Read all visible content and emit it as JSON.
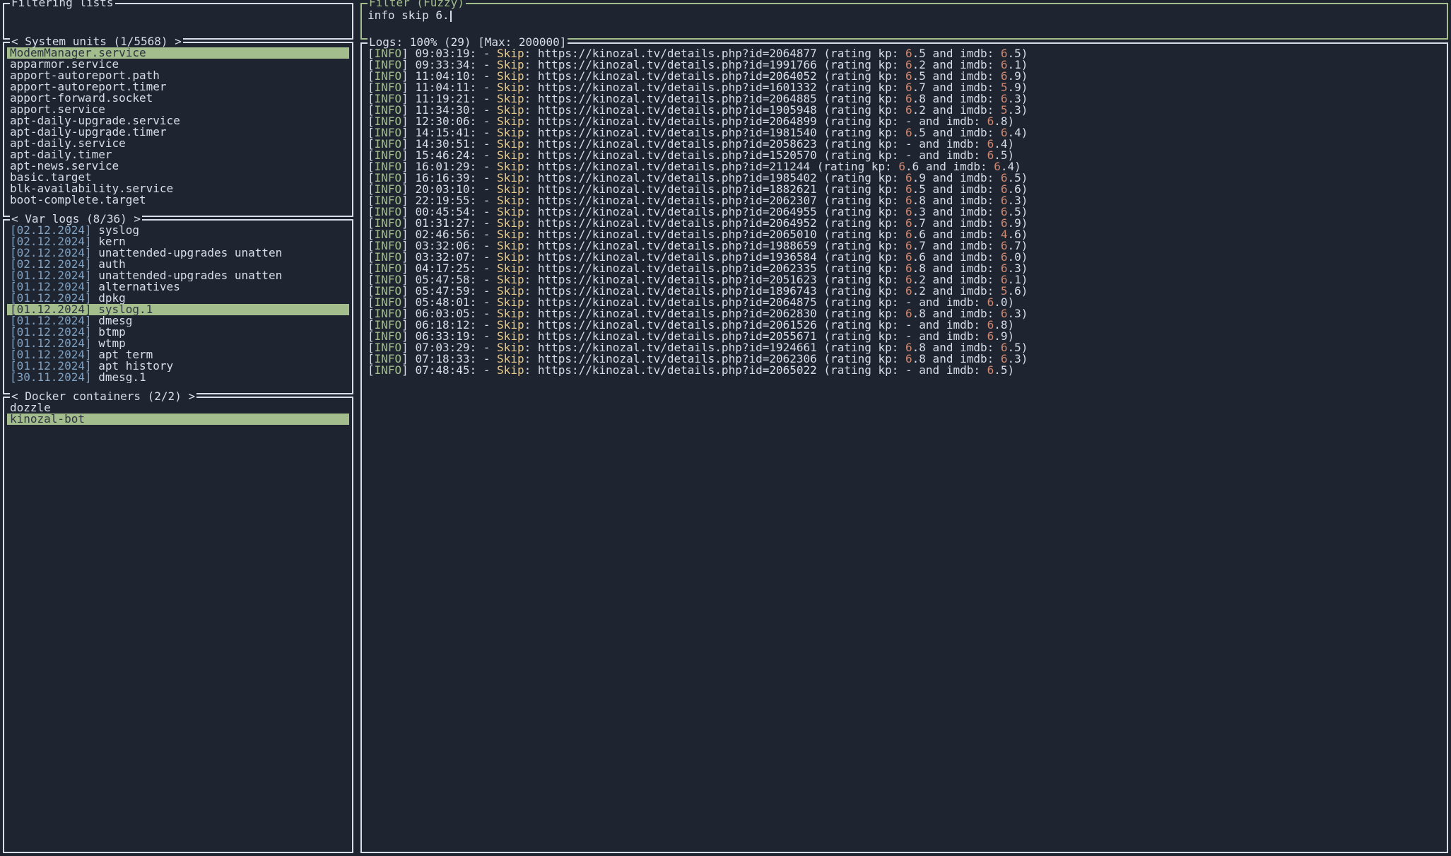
{
  "panels": {
    "filtering_lists_title": "Filtering lists",
    "filter_title": "Filter (Fuzzy)",
    "filter_value": "info skip 6.",
    "system_units_title": "< System units (1/5568) >",
    "var_logs_title": "< Var logs (8/36) >",
    "docker_title": "< Docker containers (2/2) >",
    "logs_title": "Logs: 100% (29) [Max: 200000]"
  },
  "system_units": [
    {
      "name": "ModemManager.service",
      "selected": true
    },
    {
      "name": "apparmor.service",
      "selected": false
    },
    {
      "name": "apport-autoreport.path",
      "selected": false
    },
    {
      "name": "apport-autoreport.timer",
      "selected": false
    },
    {
      "name": "apport-forward.socket",
      "selected": false
    },
    {
      "name": "apport.service",
      "selected": false
    },
    {
      "name": "apt-daily-upgrade.service",
      "selected": false
    },
    {
      "name": "apt-daily-upgrade.timer",
      "selected": false
    },
    {
      "name": "apt-daily.service",
      "selected": false
    },
    {
      "name": "apt-daily.timer",
      "selected": false
    },
    {
      "name": "apt-news.service",
      "selected": false
    },
    {
      "name": "basic.target",
      "selected": false
    },
    {
      "name": "blk-availability.service",
      "selected": false
    },
    {
      "name": "boot-complete.target",
      "selected": false
    }
  ],
  "var_logs": [
    {
      "date": "02.12.2024",
      "name": "syslog",
      "selected": false
    },
    {
      "date": "02.12.2024",
      "name": "kern",
      "selected": false
    },
    {
      "date": "02.12.2024",
      "name": "unattended-upgrades unatten",
      "selected": false
    },
    {
      "date": "02.12.2024",
      "name": "auth",
      "selected": false
    },
    {
      "date": "01.12.2024",
      "name": "unattended-upgrades unatten",
      "selected": false
    },
    {
      "date": "01.12.2024",
      "name": "alternatives",
      "selected": false
    },
    {
      "date": "01.12.2024",
      "name": "dpkg",
      "selected": false
    },
    {
      "date": "01.12.2024",
      "name": "syslog.1",
      "selected": true
    },
    {
      "date": "01.12.2024",
      "name": "dmesg",
      "selected": false
    },
    {
      "date": "01.12.2024",
      "name": "btmp",
      "selected": false
    },
    {
      "date": "01.12.2024",
      "name": "wtmp",
      "selected": false
    },
    {
      "date": "01.12.2024",
      "name": "apt term",
      "selected": false
    },
    {
      "date": "01.12.2024",
      "name": "apt history",
      "selected": false
    },
    {
      "date": "30.11.2024",
      "name": "dmesg.1",
      "selected": false
    }
  ],
  "docker": [
    {
      "name": "dozzle",
      "selected": false
    },
    {
      "name": "kinozal-bot",
      "selected": true
    }
  ],
  "logs": [
    {
      "level": "INFO",
      "time": "09:03:19",
      "id": "2064877",
      "kp": "6.5",
      "imdb": "6.5"
    },
    {
      "level": "INFO",
      "time": "09:33:34",
      "id": "1991766",
      "kp": "6.2",
      "imdb": "6.1"
    },
    {
      "level": "INFO",
      "time": "11:04:10",
      "id": "2064052",
      "kp": "6.5",
      "imdb": "6.9"
    },
    {
      "level": "INFO",
      "time": "11:04:11",
      "id": "1601332",
      "kp": "6.7",
      "imdb": "5.9"
    },
    {
      "level": "INFO",
      "time": "11:19:21",
      "id": "2064885",
      "kp": "6.8",
      "imdb": "6.3"
    },
    {
      "level": "INFO",
      "time": "11:34:30",
      "id": "1905948",
      "kp": "6.2",
      "imdb": "5.3"
    },
    {
      "level": "INFO",
      "time": "12:30:06",
      "id": "2064899",
      "kp": "-",
      "imdb": "6.8"
    },
    {
      "level": "INFO",
      "time": "14:15:41",
      "id": "1981540",
      "kp": "6.5",
      "imdb": "6.4"
    },
    {
      "level": "INFO",
      "time": "14:30:51",
      "id": "2058623",
      "kp": "-",
      "imdb": "6.4"
    },
    {
      "level": "INFO",
      "time": "15:46:24",
      "id": "1520570",
      "kp": "-",
      "imdb": "6.5"
    },
    {
      "level": "INFO",
      "time": "16:01:29",
      "id": "211244",
      "kp": "6.6",
      "imdb": "6.4"
    },
    {
      "level": "INFO",
      "time": "16:16:39",
      "id": "1985402",
      "kp": "6.9",
      "imdb": "6.5"
    },
    {
      "level": "INFO",
      "time": "20:03:10",
      "id": "1882621",
      "kp": "6.5",
      "imdb": "6.6"
    },
    {
      "level": "INFO",
      "time": "22:19:55",
      "id": "2062307",
      "kp": "6.8",
      "imdb": "6.3"
    },
    {
      "level": "INFO",
      "time": "00:45:54",
      "id": "2064955",
      "kp": "6.3",
      "imdb": "6.5"
    },
    {
      "level": "INFO",
      "time": "01:31:27",
      "id": "2064952",
      "kp": "6.7",
      "imdb": "6.9"
    },
    {
      "level": "INFO",
      "time": "02:46:56",
      "id": "2065010",
      "kp": "6.6",
      "imdb": "4.6"
    },
    {
      "level": "INFO",
      "time": "03:32:06",
      "id": "1988659",
      "kp": "6.7",
      "imdb": "6.7"
    },
    {
      "level": "INFO",
      "time": "03:32:07",
      "id": "1936584",
      "kp": "6.6",
      "imdb": "6.0"
    },
    {
      "level": "INFO",
      "time": "04:17:25",
      "id": "2062335",
      "kp": "6.8",
      "imdb": "6.3"
    },
    {
      "level": "INFO",
      "time": "05:47:58",
      "id": "2051623",
      "kp": "6.2",
      "imdb": "6.1"
    },
    {
      "level": "INFO",
      "time": "05:47:59",
      "id": "1896743",
      "kp": "6.2",
      "imdb": "5.6"
    },
    {
      "level": "INFO",
      "time": "05:48:01",
      "id": "2064875",
      "kp": "-",
      "imdb": "6.0"
    },
    {
      "level": "INFO",
      "time": "06:03:05",
      "id": "2062830",
      "kp": "6.8",
      "imdb": "6.3"
    },
    {
      "level": "INFO",
      "time": "06:18:12",
      "id": "2061526",
      "kp": "-",
      "imdb": "6.8"
    },
    {
      "level": "INFO",
      "time": "06:33:19",
      "id": "2055671",
      "kp": "-",
      "imdb": "6.9"
    },
    {
      "level": "INFO",
      "time": "07:03:29",
      "id": "1924661",
      "kp": "6.8",
      "imdb": "6.5"
    },
    {
      "level": "INFO",
      "time": "07:18:33",
      "id": "2062306",
      "kp": "6.8",
      "imdb": "6.3"
    },
    {
      "level": "INFO",
      "time": "07:48:45",
      "id": "2065022",
      "kp": "-",
      "imdb": "6.5"
    }
  ]
}
